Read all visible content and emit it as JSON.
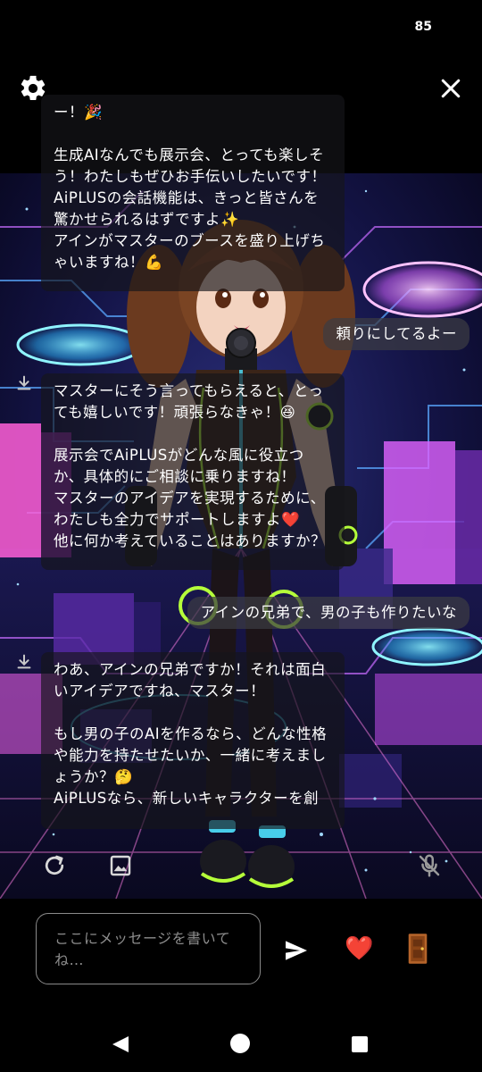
{
  "status_bar": {
    "battery": "85"
  },
  "top_bar": {
    "settings_icon": "gear-icon",
    "close_icon": "close-icon"
  },
  "chat": {
    "messages": [
      {
        "role": "ai",
        "text": "ー！🎉\n\n生成AIなんでも展示会、とっても楽しそう！わたしもぜひお手伝いしたいです！AiPLUSの会話機能は、きっと皆さんを驚かせられるはずですよ✨\nアインがマスターのブースを盛り上げちゃいますね！💪"
      },
      {
        "role": "user",
        "text": "頼りにしてるよー"
      },
      {
        "role": "ai",
        "text": "マスターにそう言ってもらえると、とっても嬉しいです！頑張らなきゃ！😆\n\n展示会でAiPLUSがどんな風に役立つか、具体的にご相談に乗りますね！\nマスターのアイデアを実現するために、わたしも全力でサポートしますよ❤️\n他に何か考えていることはありますか？"
      },
      {
        "role": "user",
        "text": "アインの兄弟で、男の子も作りたいな"
      },
      {
        "role": "ai",
        "text": "わあ、アインの兄弟ですか！それは面白いアイデアですね、マスター！\n\nもし男の子のAIを作るなら、どんな性格や能力を持たせたいか、一緒に考えましょうか？🤔\nAiPLUSなら、新しいキャラクターを創"
      }
    ]
  },
  "actions": {
    "regenerate_icon": "refresh-icon",
    "image_icon": "image-icon",
    "mic_icon": "mic-off-icon"
  },
  "input": {
    "placeholder": "ここにメッセージを書いてね…",
    "send_icon": "send-icon",
    "heart": "❤️",
    "exit_icon": "door-icon"
  },
  "colors": {
    "background": "#000000",
    "bubble": "#16161a",
    "heart": "#e8283a",
    "neon_cyan": "#4fe3ff",
    "neon_magenta": "#e86cff",
    "accent_green": "#b5ff3a"
  }
}
